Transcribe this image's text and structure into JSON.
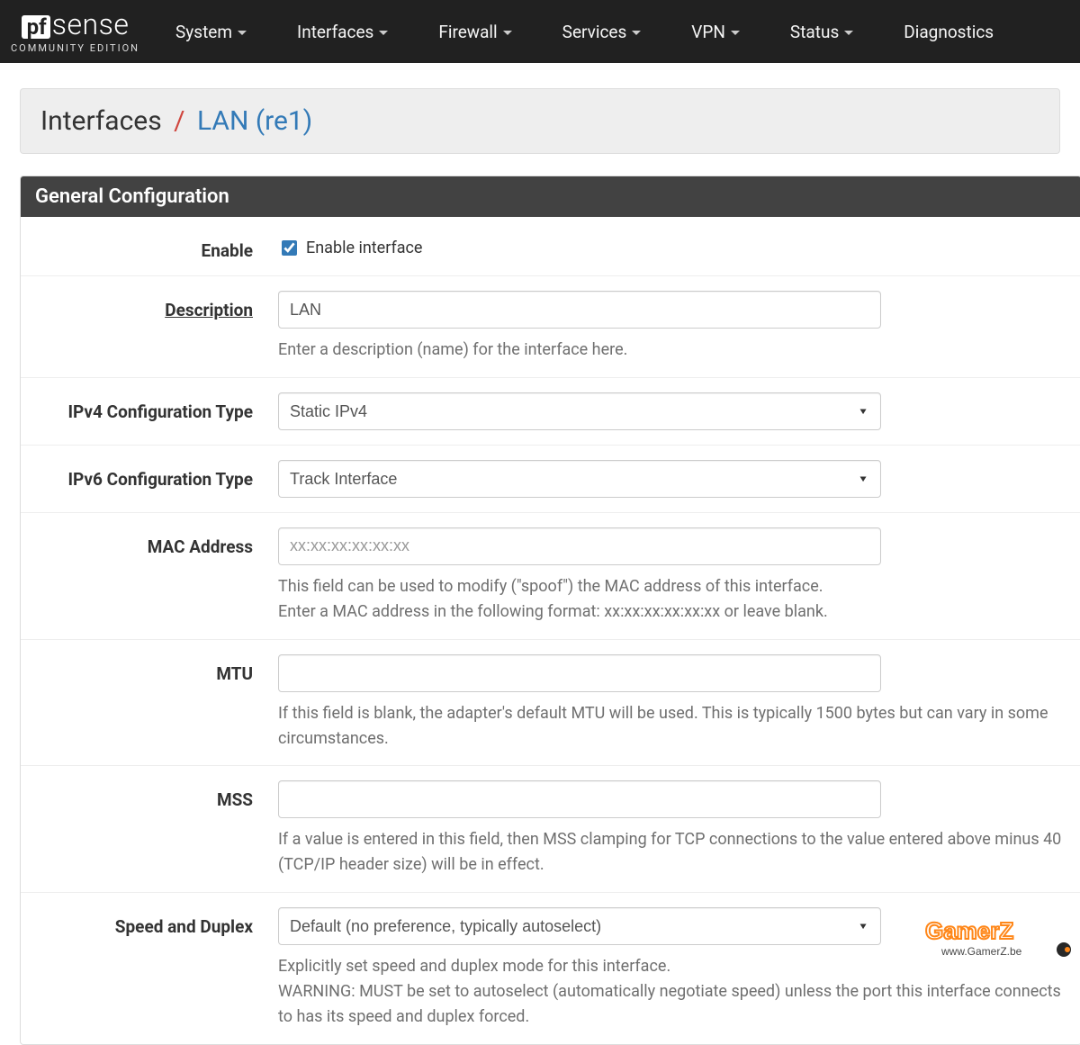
{
  "brand": {
    "box": "pf",
    "text": "sense",
    "subtitle": "COMMUNITY EDITION"
  },
  "nav": {
    "items": [
      "System",
      "Interfaces",
      "Firewall",
      "Services",
      "VPN",
      "Status",
      "Diagnostics"
    ]
  },
  "breadcrumb": {
    "root": "Interfaces",
    "active": "LAN (re1)"
  },
  "panel": {
    "title": "General Configuration"
  },
  "fields": {
    "enable": {
      "label": "Enable",
      "checkbox_label": "Enable interface",
      "checked": true
    },
    "description": {
      "label": "Description",
      "value": "LAN",
      "help": "Enter a description (name) for the interface here."
    },
    "ipv4": {
      "label": "IPv4 Configuration Type",
      "value": "Static IPv4"
    },
    "ipv6": {
      "label": "IPv6 Configuration Type",
      "value": "Track Interface"
    },
    "mac": {
      "label": "MAC Address",
      "value": "",
      "placeholder": "xx:xx:xx:xx:xx:xx",
      "help1": "This field can be used to modify (\"spoof\") the MAC address of this interface.",
      "help2": "Enter a MAC address in the following format: xx:xx:xx:xx:xx:xx or leave blank."
    },
    "mtu": {
      "label": "MTU",
      "value": "",
      "help": "If this field is blank, the adapter's default MTU will be used. This is typically 1500 bytes but can vary in some circumstances."
    },
    "mss": {
      "label": "MSS",
      "value": "",
      "help": "If a value is entered in this field, then MSS clamping for TCP connections to the value entered above minus 40 (TCP/IP header size) will be in effect."
    },
    "speed": {
      "label": "Speed and Duplex",
      "value": "Default (no preference, typically autoselect)",
      "help1": "Explicitly set speed and duplex mode for this interface.",
      "help2": "WARNING: MUST be set to autoselect (automatically negotiate speed) unless the port this interface connects to has its speed and duplex forced."
    }
  },
  "watermark": {
    "line1": "GamerZ",
    "line2": "www.GamerZ.be"
  }
}
